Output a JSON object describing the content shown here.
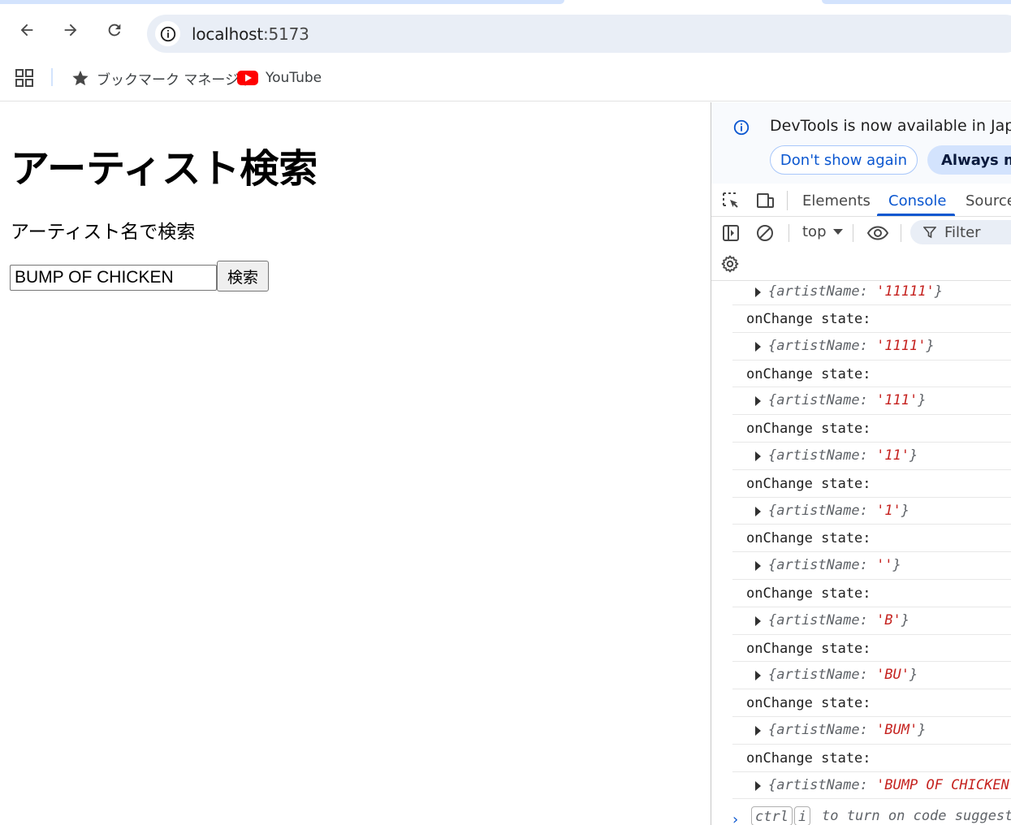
{
  "browser": {
    "url_host": "localhost",
    "url_port": ":5173",
    "bookmarks": [
      {
        "label": "ブックマーク マネージャ",
        "icon": "star-icon"
      },
      {
        "label": "YouTube",
        "icon": "youtube-icon"
      }
    ]
  },
  "page": {
    "title": "アーティスト検索",
    "subtitle": "アーティスト名で検索",
    "search_value": "BUMP OF CHICKEN",
    "search_button": "検索"
  },
  "devtools": {
    "banner_message": "DevTools is now available in Japanese",
    "banner_dismiss": "Don't show again",
    "banner_accept": "Always match Chrome's language",
    "tabs": [
      "Elements",
      "Console",
      "Sources"
    ],
    "active_tab": "Console",
    "context": "top",
    "filter_placeholder": "Filter",
    "log_label": "onChange state:",
    "entries": [
      {
        "key": "{artistName: ",
        "value": "'11111'",
        "close": "}"
      },
      {
        "key": "{artistName: ",
        "value": "'1111'",
        "close": "}"
      },
      {
        "key": "{artistName: ",
        "value": "'111'",
        "close": "}"
      },
      {
        "key": "{artistName: ",
        "value": "'11'",
        "close": "}"
      },
      {
        "key": "{artistName: ",
        "value": "'1'",
        "close": "}"
      },
      {
        "key": "{artistName: ",
        "value": "''",
        "close": "}"
      },
      {
        "key": "{artistName: ",
        "value": "'B'",
        "close": "}"
      },
      {
        "key": "{artistName: ",
        "value": "'BU'",
        "close": "}"
      },
      {
        "key": "{artistName: ",
        "value": "'BUM'",
        "close": "}"
      },
      {
        "key": "{artistName: ",
        "value": "'BUMP OF CHICKEN'",
        "close": "}"
      }
    ],
    "prompt_key1": "ctrl",
    "prompt_key2": "i",
    "prompt_hint": "to turn on code suggestions"
  },
  "colors": {
    "accent": "#0b57d0",
    "string_value": "#c5221f",
    "youtube_red": "#ff0000"
  }
}
